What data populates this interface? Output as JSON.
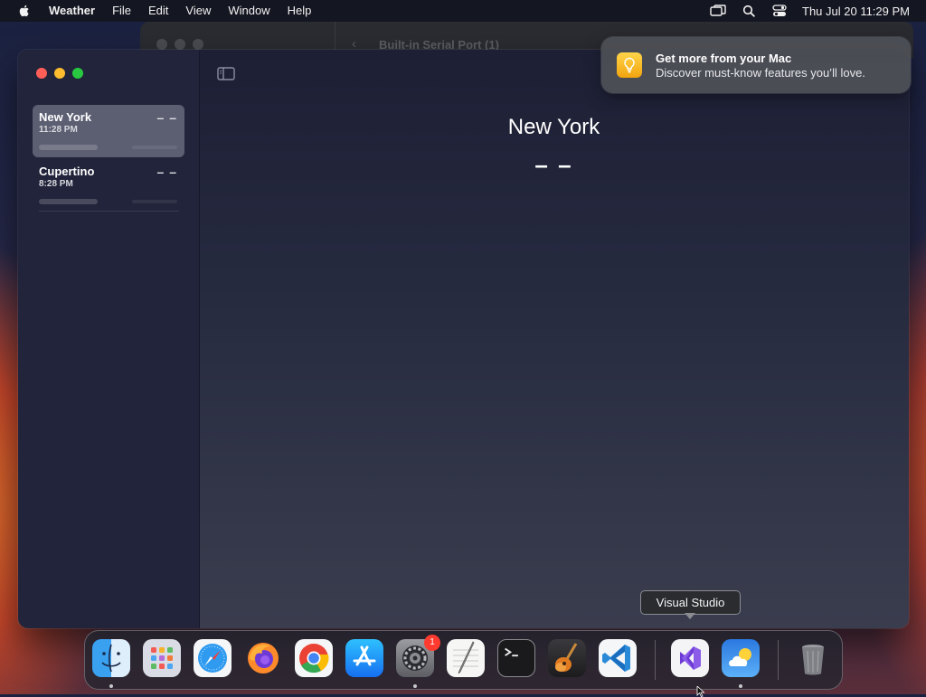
{
  "menubar": {
    "app_name": "Weather",
    "items": [
      "File",
      "Edit",
      "View",
      "Window",
      "Help"
    ],
    "clock": "Thu Jul 20  11:29 PM",
    "status_icons": [
      "screen-mirroring-icon",
      "spotlight-search-icon",
      "control-center-icon"
    ]
  },
  "background_window": {
    "title": "Built-in Serial Port (1)"
  },
  "sidebar": {
    "cities": [
      {
        "name": "New York",
        "time": "11:28 PM",
        "temp": "– –",
        "selected": true
      },
      {
        "name": "Cupertino",
        "time": "8:28 PM",
        "temp": "– –",
        "selected": false
      }
    ]
  },
  "main": {
    "city": "New York",
    "temp": "– –"
  },
  "notification": {
    "title": "Get more from your Mac",
    "body": "Discover must-know features you’ll love.",
    "icon": "lightbulb-icon"
  },
  "tooltip": {
    "text": "Visual Studio"
  },
  "dock": {
    "apps": [
      {
        "name": "Finder",
        "icon": "finder-icon",
        "running": true
      },
      {
        "name": "Launchpad",
        "icon": "launchpad-icon",
        "running": false
      },
      {
        "name": "Safari",
        "icon": "safari-icon",
        "running": false
      },
      {
        "name": "Firefox",
        "icon": "firefox-icon",
        "running": false
      },
      {
        "name": "Chrome",
        "icon": "chrome-icon",
        "running": false
      },
      {
        "name": "App Store",
        "icon": "app-store-icon",
        "running": false
      },
      {
        "name": "System Settings",
        "icon": "system-settings-icon",
        "running": true,
        "badge": "1"
      },
      {
        "name": "TextEdit",
        "icon": "textedit-icon",
        "running": false
      },
      {
        "name": "Terminal",
        "icon": "terminal-icon",
        "running": false
      },
      {
        "name": "GarageBand",
        "icon": "garageband-icon",
        "running": false
      },
      {
        "name": "Visual Studio Code",
        "icon": "vscode-icon",
        "running": false
      },
      {
        "name": "Visual Studio",
        "icon": "visual-studio-icon",
        "running": false
      },
      {
        "name": "Weather",
        "icon": "weather-icon",
        "running": true
      },
      {
        "name": "Trash",
        "icon": "trash-icon",
        "running": false
      }
    ]
  },
  "colors": {
    "accent_red": "#ff5f57",
    "accent_yellow": "#febc2e",
    "accent_green": "#28c840",
    "badge": "#ff3b30"
  }
}
